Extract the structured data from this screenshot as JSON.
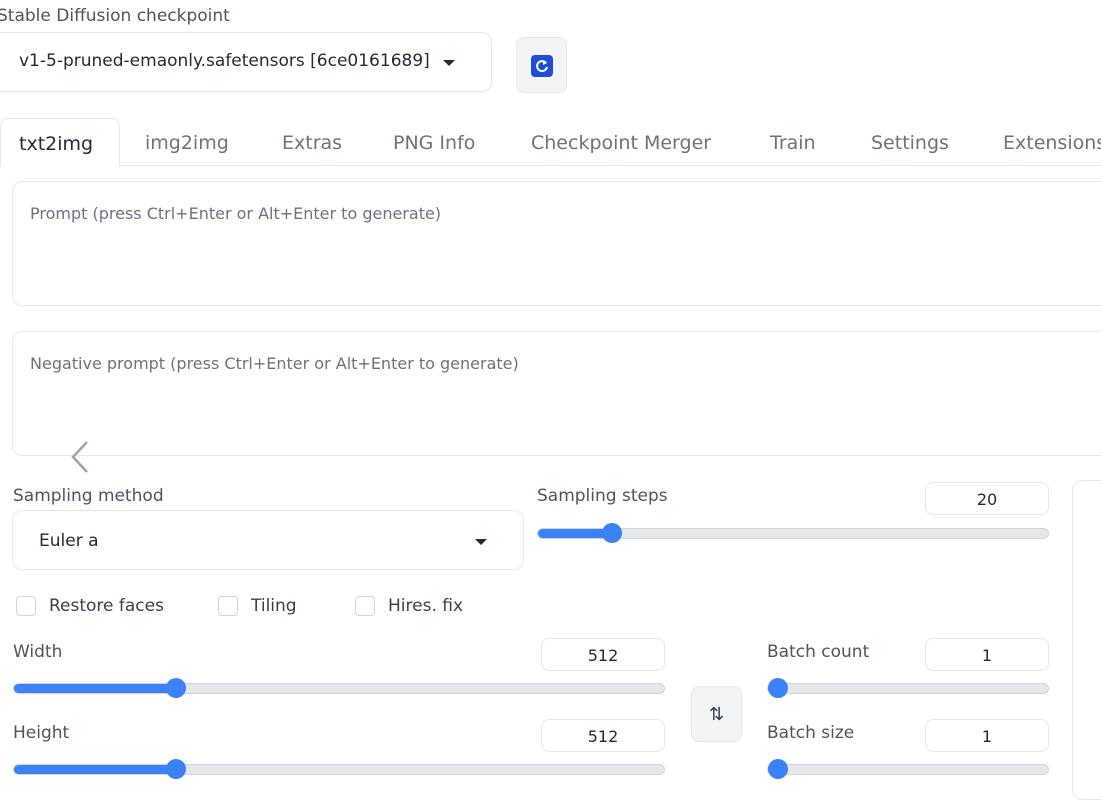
{
  "checkpoint": {
    "label": "Stable Diffusion checkpoint",
    "value": "v1-5-pruned-emaonly.safetensors [6ce0161689]"
  },
  "tabs": [
    {
      "label": "txt2img",
      "active": true
    },
    {
      "label": "img2img",
      "active": false
    },
    {
      "label": "Extras",
      "active": false
    },
    {
      "label": "PNG Info",
      "active": false
    },
    {
      "label": "Checkpoint Merger",
      "active": false
    },
    {
      "label": "Train",
      "active": false
    },
    {
      "label": "Settings",
      "active": false
    },
    {
      "label": "Extensions",
      "active": false
    }
  ],
  "prompt": {
    "placeholder": "Prompt (press Ctrl+Enter or Alt+Enter to generate)"
  },
  "negative_prompt": {
    "placeholder": "Negative prompt (press Ctrl+Enter or Alt+Enter to generate)"
  },
  "sampling_method": {
    "label": "Sampling method",
    "value": "Euler a"
  },
  "sampling_steps": {
    "label": "Sampling steps",
    "value": "20",
    "fraction": 0.13
  },
  "checkboxes": [
    {
      "label": "Restore faces",
      "checked": false
    },
    {
      "label": "Tiling",
      "checked": false
    },
    {
      "label": "Hires. fix",
      "checked": false
    }
  ],
  "width": {
    "label": "Width",
    "value": "512",
    "fraction": 0.24
  },
  "height": {
    "label": "Height",
    "value": "512",
    "fraction": 0.24
  },
  "batch_count": {
    "label": "Batch count",
    "value": "1",
    "fraction": 0.0
  },
  "batch_size": {
    "label": "Batch size",
    "value": "1",
    "fraction": 0.0
  },
  "swap_icon": "⇅",
  "colors": {
    "accent": "#3b82f6",
    "refresh": "#1d4ed8"
  }
}
